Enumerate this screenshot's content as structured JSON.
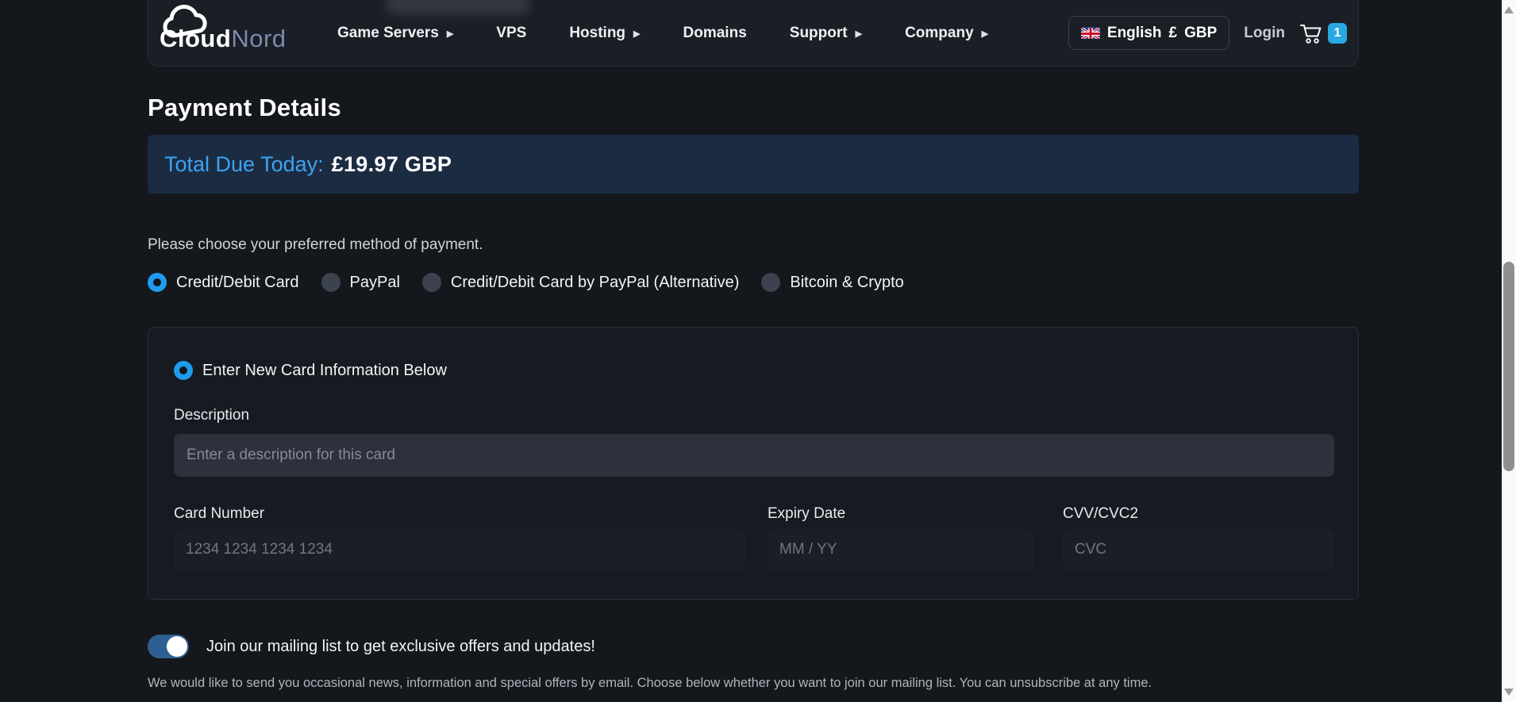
{
  "nav": {
    "logo_cloud": "Cloud",
    "logo_nord": "Nord",
    "items": [
      {
        "label": "Game Servers",
        "has_submenu": true
      },
      {
        "label": "VPS",
        "has_submenu": false
      },
      {
        "label": "Hosting",
        "has_submenu": true
      },
      {
        "label": "Domains",
        "has_submenu": false
      },
      {
        "label": "Support",
        "has_submenu": true
      },
      {
        "label": "Company",
        "has_submenu": true
      }
    ],
    "language_selector": {
      "language": "English",
      "currency_symbol": "£",
      "currency": "GBP"
    },
    "login_label": "Login",
    "cart_badge": "1"
  },
  "page": {
    "title": "Payment Details",
    "total_due_label": "Total Due Today:",
    "total_due_value": "£19.97 GBP",
    "method_prompt": "Please choose your preferred method of payment.",
    "payment_methods": [
      {
        "label": "Credit/Debit Card",
        "selected": true
      },
      {
        "label": "PayPal",
        "selected": false
      },
      {
        "label": "Credit/Debit Card by PayPal (Alternative)",
        "selected": false
      },
      {
        "label": "Bitcoin & Crypto",
        "selected": false
      }
    ],
    "card_form": {
      "new_card_option": "Enter New Card Information Below",
      "new_card_selected": true,
      "description_label": "Description",
      "description_placeholder": "Enter a description for this card",
      "card_number_label": "Card Number",
      "card_number_placeholder": "1234 1234 1234 1234",
      "expiry_label": "Expiry Date",
      "expiry_placeholder": "MM / YY",
      "cvv_label": "CVV/CVC2",
      "cvv_placeholder": "CVC"
    },
    "mailing": {
      "toggle_on": true,
      "toggle_label": "Join our mailing list to get exclusive offers and updates!",
      "description": "We would like to send you occasional news, information and special offers by email. Choose below whether you want to join our mailing list. You can unsubscribe at any time."
    }
  },
  "colors": {
    "accent_blue": "#1f9bf0",
    "banner_bg": "#1b2c42",
    "banner_label": "#3ea2f2",
    "badge_bg": "#29a9e1",
    "toggle_on": "#2d6090"
  }
}
